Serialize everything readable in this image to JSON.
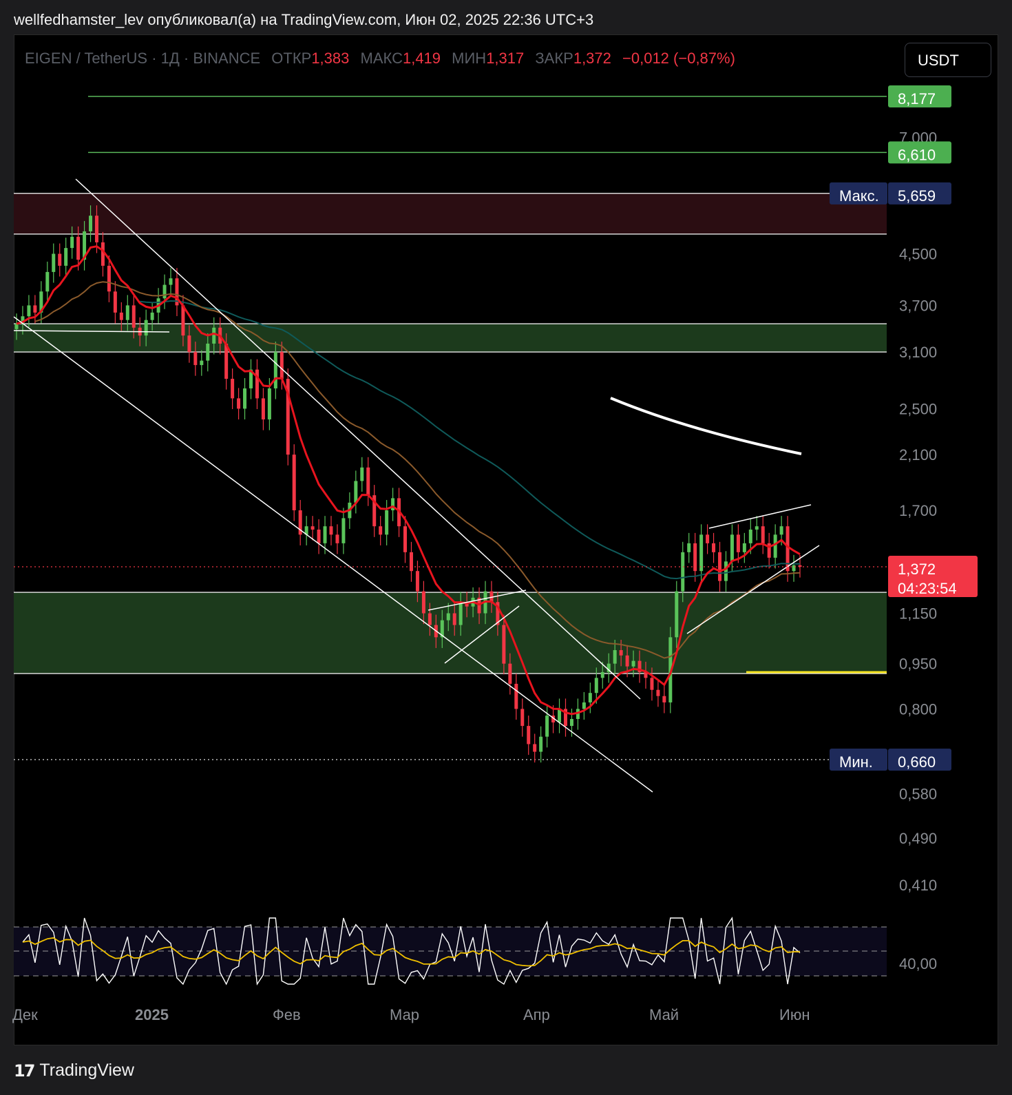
{
  "header": {
    "publisher_line": "wellfedhamster_lev опубликовал(а) на TradingView.com, Июн 02, 2025 22:36 UTC+3"
  },
  "legend": {
    "symbol": "EIGEN / TetherUS · 1Д · BINANCE",
    "open_label": "ОТКР",
    "open": "1,383",
    "high_label": "МАКС",
    "high": "1,419",
    "low_label": "МИН",
    "low": "1,317",
    "close_label": "ЗАКР",
    "close": "1,372",
    "change": "−0,012 (−0,87%)"
  },
  "currency_button": "USDT",
  "footer": {
    "logo_text": "TradingView"
  },
  "colors": {
    "bull": "#26a69a",
    "bull_bright": "#5ac45a",
    "bear": "#f23645",
    "ema_fast": "#e8141e",
    "ema_slow": "#8b5a2b",
    "ema_long": "#0f5a5a",
    "zone_green": "#1c3a1c",
    "zone_red": "#2b0d12",
    "level_green": "#5ab85a",
    "rsi": "#ffffff",
    "rsi_ma": "#f0c000"
  },
  "chart_data": {
    "type": "candlestick",
    "pair": "EIGEN / TetherUS",
    "timeframe": "1Д",
    "exchange": "BINANCE",
    "scale": "log",
    "price_ticks": [
      "7,000",
      "4,500",
      "3,700",
      "3,100",
      "2,500",
      "2,100",
      "1,700",
      "1,150",
      "0,950",
      "0,800",
      "0,580",
      "0,490",
      "0,410"
    ],
    "time_ticks": [
      "Дек",
      "2025",
      "Фев",
      "Мар",
      "Апр",
      "Май",
      "Июн"
    ],
    "levels": [
      {
        "price": 8.177,
        "label": "8,177",
        "kind": "target"
      },
      {
        "price": 6.61,
        "label": "6,610",
        "kind": "target"
      },
      {
        "price": 5.659,
        "label": "5,659",
        "tag": "Макс.",
        "kind": "max"
      },
      {
        "price": 0.66,
        "label": "0,660",
        "tag": "Мин.",
        "kind": "min"
      }
    ],
    "zones": [
      {
        "from": 4.85,
        "to": 5.66,
        "kind": "resistance"
      },
      {
        "from": 3.1,
        "to": 3.45,
        "kind": "support"
      },
      {
        "from": 0.915,
        "to": 1.245,
        "kind": "support"
      }
    ],
    "last_price": {
      "label": "1,372",
      "countdown": "04:23:54"
    },
    "closes": [
      3.45,
      3.55,
      3.7,
      3.6,
      3.9,
      4.2,
      4.5,
      4.3,
      4.6,
      4.8,
      4.4,
      4.9,
      5.2,
      4.7,
      4.3,
      3.9,
      3.6,
      3.5,
      3.7,
      3.4,
      3.3,
      3.5,
      3.6,
      3.8,
      4.0,
      4.1,
      3.7,
      3.3,
      3.1,
      2.95,
      3.0,
      3.2,
      3.4,
      3.2,
      2.8,
      2.6,
      2.5,
      2.7,
      2.9,
      2.6,
      2.4,
      2.7,
      3.1,
      2.8,
      2.1,
      1.7,
      1.55,
      1.6,
      1.58,
      1.5,
      1.6,
      1.55,
      1.5,
      1.65,
      1.75,
      1.9,
      2.0,
      1.8,
      1.6,
      1.55,
      1.7,
      1.78,
      1.6,
      1.45,
      1.35,
      1.25,
      1.15,
      1.1,
      1.05,
      1.12,
      1.15,
      1.1,
      1.2,
      1.18,
      1.22,
      1.15,
      1.25,
      1.2,
      1.1,
      0.95,
      0.88,
      0.8,
      0.75,
      0.7,
      0.68,
      0.72,
      0.78,
      0.76,
      0.8,
      0.75,
      0.77,
      0.8,
      0.82,
      0.85,
      0.9,
      0.92,
      0.95,
      1.0,
      0.98,
      0.94,
      0.96,
      0.92,
      0.9,
      0.86,
      0.84,
      0.82,
      1.05,
      1.25,
      1.45,
      1.5,
      1.35,
      1.55,
      1.5,
      1.45,
      1.3,
      1.4,
      1.55,
      1.45,
      1.5,
      1.58,
      1.6,
      1.5,
      1.42,
      1.55,
      1.6,
      1.35,
      1.38,
      1.372
    ]
  }
}
